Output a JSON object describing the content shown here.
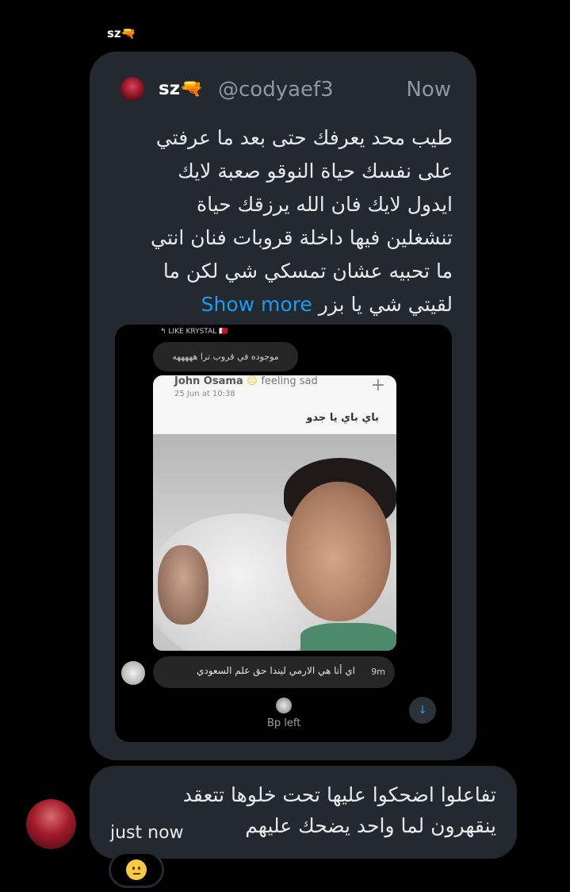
{
  "thread": {
    "sender_name": "sz🔫"
  },
  "quoted_post": {
    "display_name": "sz🔫",
    "handle": "@codyaef3",
    "time": "Now",
    "text": "طيب محد يعرفك حتى بعد ما عرفتي على نفسك حياة النوقو صعبة لايك ايدول لايك فان الله يرزقك حياة تنشغلين فيها داخلة قروبات فنان انتي ما تحبيه عشان تمسكي شي لكن ما لقيتي شي يا بزر ",
    "show_more_label": "Show more",
    "media": {
      "reply_reference": "↰ LIKE KRYSTAL 🇧🇭",
      "bubble_top_text": "موجوده في قروب ترا هههههه",
      "post": {
        "author": "John Osama",
        "status": "feeling sad",
        "date": "25 Jun at 10:38",
        "caption": "باي باي يا جدو"
      },
      "bubble_bottom_text": "اي أنا هي الارمي ليندا حق علم السعودي",
      "bubble_bottom_time": "9m",
      "left_notice": "Bp left",
      "scroll_button_glyph": "↓"
    }
  },
  "message": {
    "text": "تفاعلوا اضحكوا عليها تحت خلوها تتعقد ينقهرون لما واحد يضحك عليهم",
    "time": "just now",
    "reaction": "🫤"
  }
}
